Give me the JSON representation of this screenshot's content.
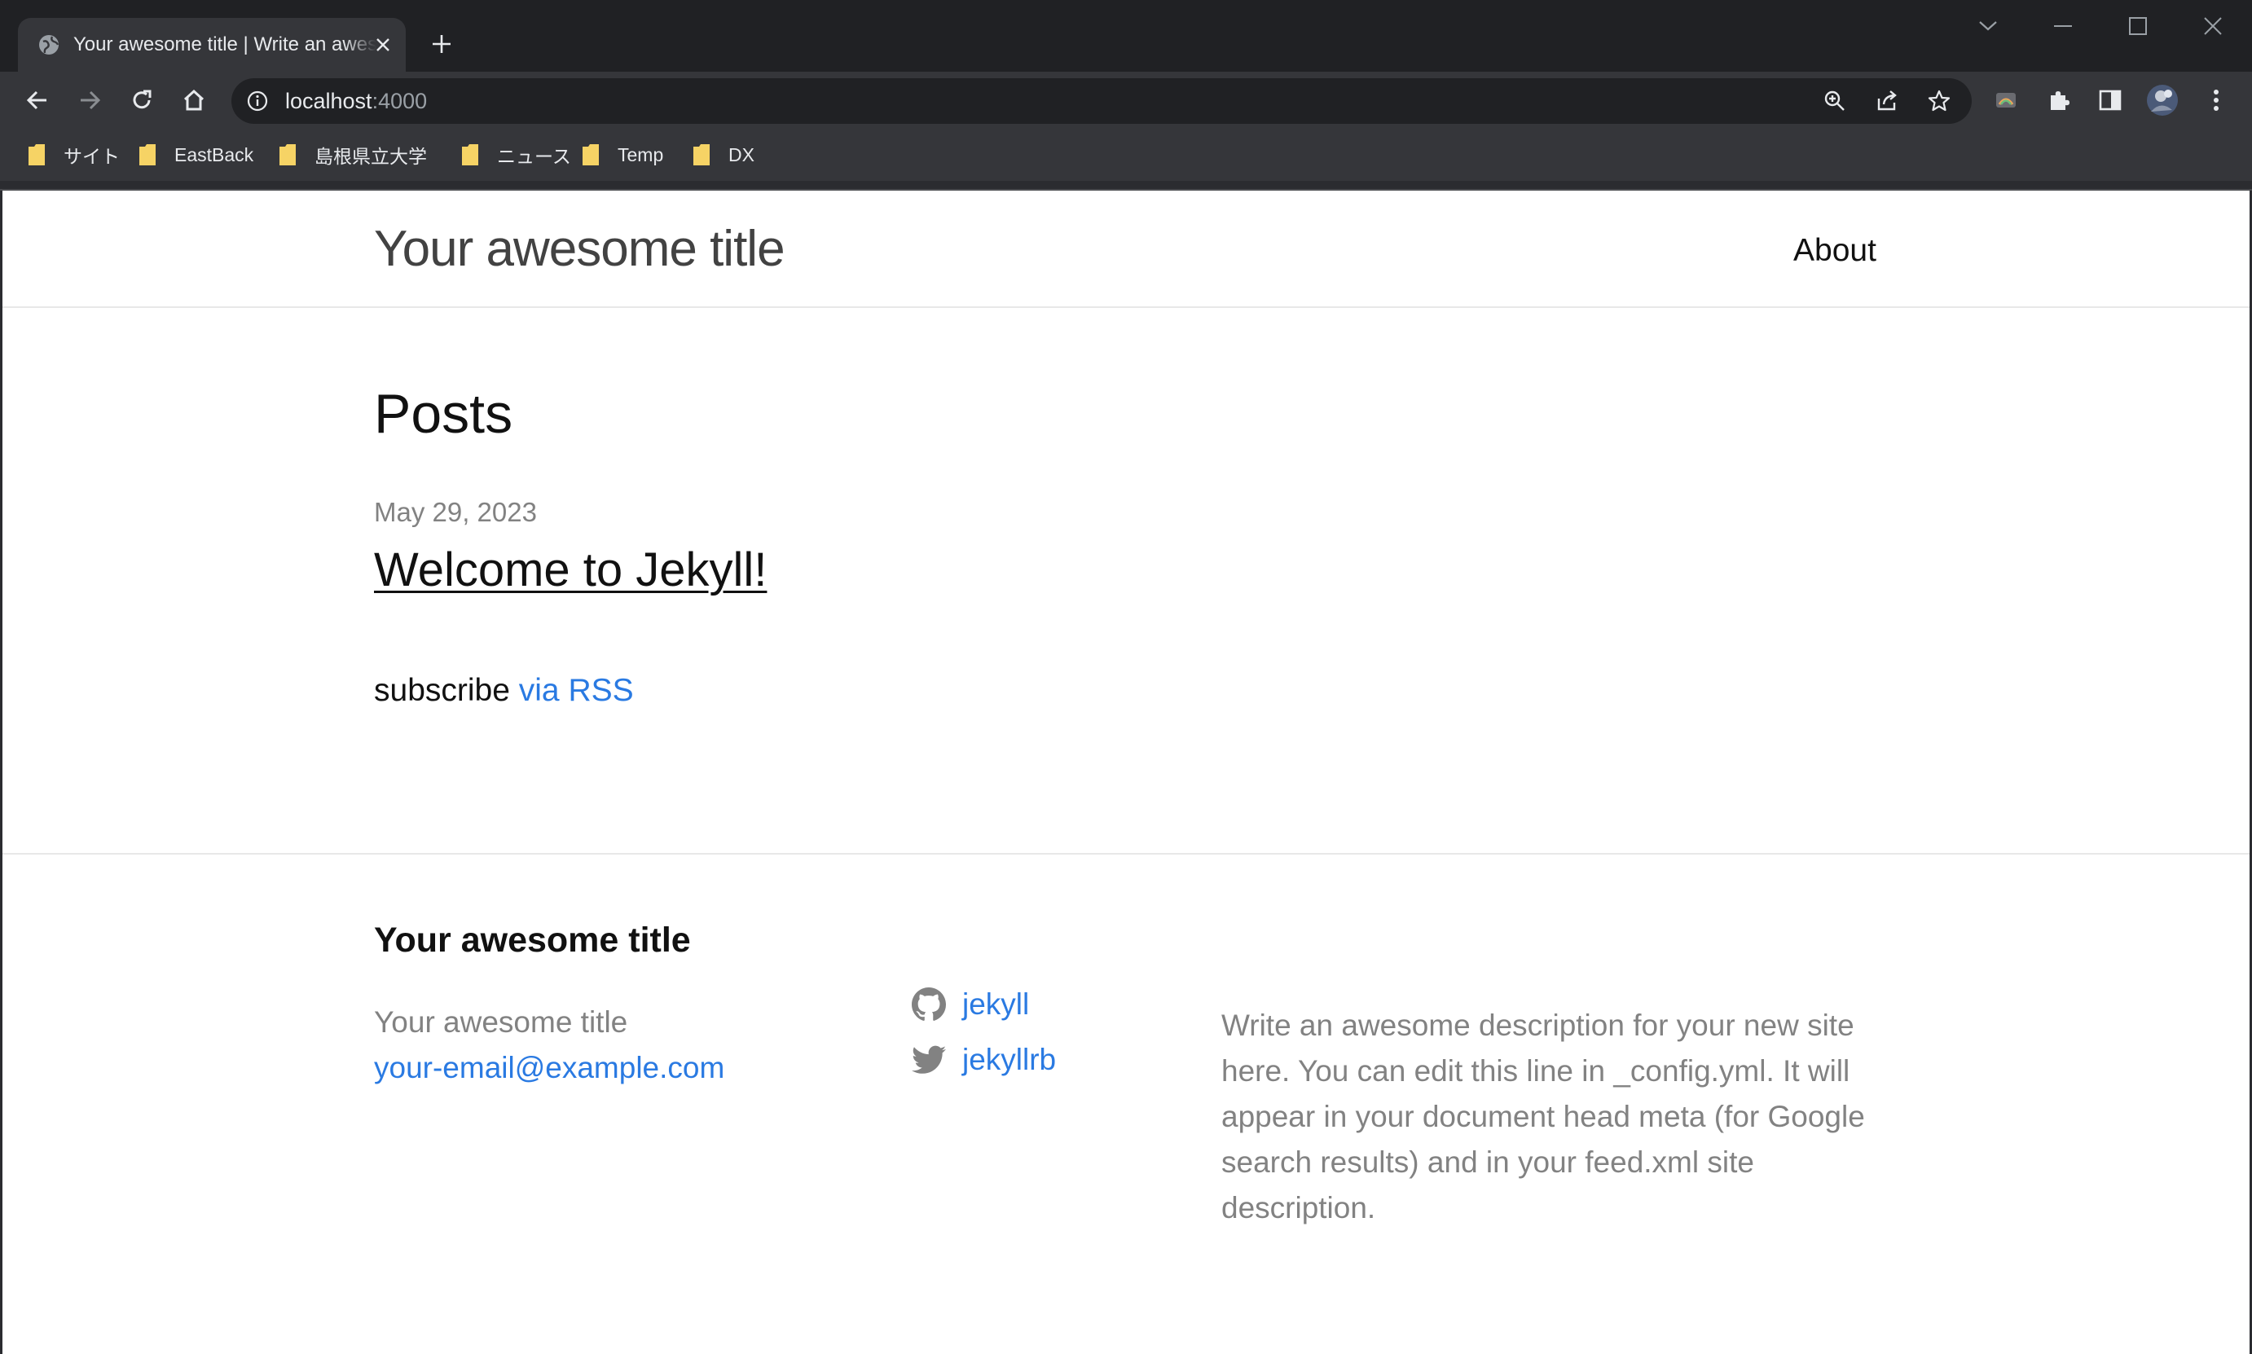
{
  "browser": {
    "tab": {
      "title": "Your awesome title | Write an awesome description for your new site here"
    },
    "address_bar": {
      "host": "localhost",
      "port": ":4000"
    },
    "bookmarks": [
      {
        "label": "サイト"
      },
      {
        "label": "EastBack"
      },
      {
        "label": "島根県立大学"
      },
      {
        "label": "ニュース"
      },
      {
        "label": "Temp"
      },
      {
        "label": "DX"
      }
    ],
    "colors": {
      "frame": "#202124",
      "toolbar": "#35363a",
      "text": "#e8eaed",
      "bookmark_folder": "#f6d365"
    }
  },
  "site": {
    "header": {
      "title": "Your awesome title",
      "nav": [
        {
          "label": "About"
        }
      ]
    },
    "main": {
      "heading": "Posts",
      "posts": [
        {
          "date": "May 29, 2023",
          "title": "Welcome to Jekyll!"
        }
      ],
      "subscribe_text": "subscribe",
      "rss_link": "via RSS"
    },
    "footer": {
      "heading": "Your awesome title",
      "name": "Your awesome title",
      "email": "your-email@example.com",
      "social": [
        {
          "icon": "github-icon",
          "label": "jekyll"
        },
        {
          "icon": "twitter-icon",
          "label": "jekyllrb"
        }
      ],
      "description": "Write an awesome description for your new site here. You can edit this line in _config.yml. It will appear in your document head meta (for Google search results) and in your feed.xml site description."
    },
    "colors": {
      "link": "#2a7ae2",
      "text": "#111111",
      "muted": "#828282",
      "border": "#e8e8e8"
    }
  }
}
